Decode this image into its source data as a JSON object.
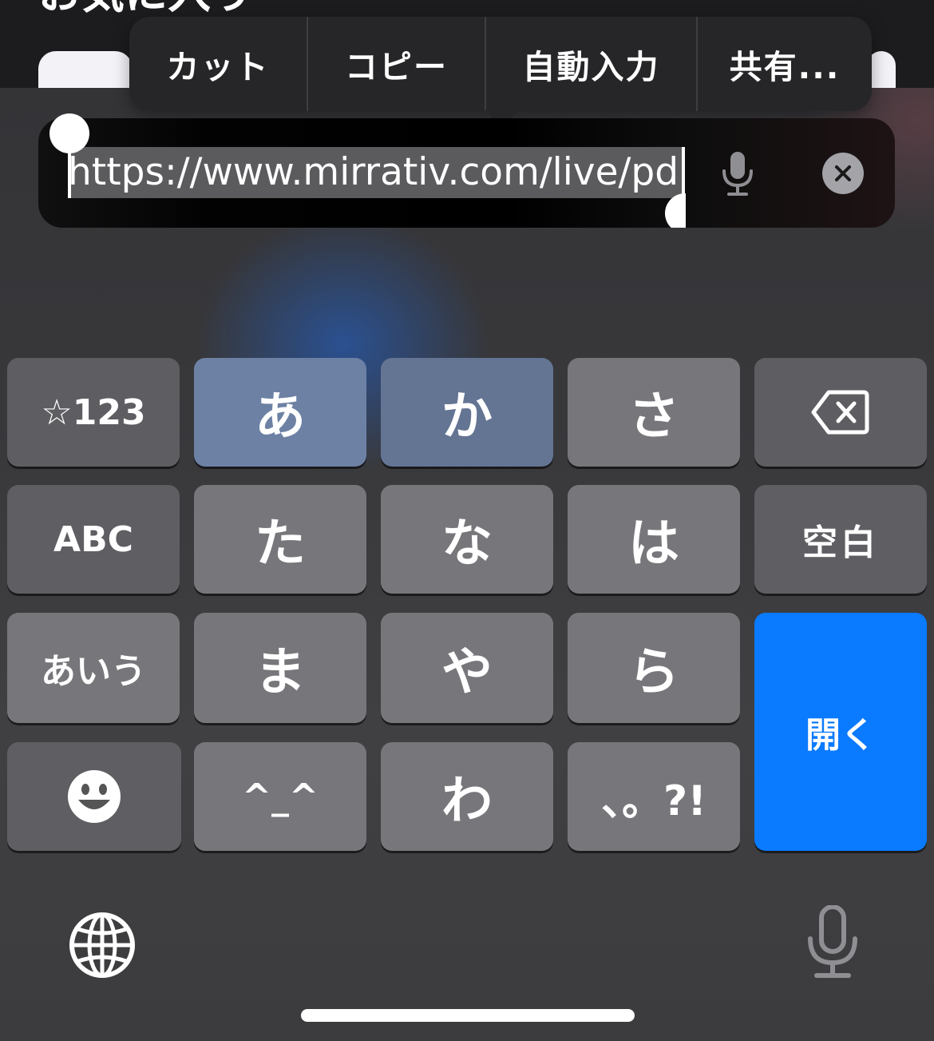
{
  "page": {
    "heading": "お気に入り"
  },
  "edit_menu": {
    "items": [
      "カット",
      "コピー",
      "自動入力",
      "共有..."
    ]
  },
  "url_field": {
    "value": "https://www.mirrativ.com/live/pd"
  },
  "keyboard": {
    "rows": [
      [
        "☆123",
        "あ",
        "か",
        "さ",
        "delete"
      ],
      [
        "ABC",
        "た",
        "な",
        "は",
        "空白"
      ],
      [
        "あいう",
        "ま",
        "や",
        "ら",
        "開く"
      ],
      [
        "emoji",
        "^_^",
        "わ_",
        "、。?!"
      ]
    ],
    "labels": {
      "mode_number": "☆123",
      "a": "あ",
      "ka": "か",
      "sa": "さ",
      "mode_abc": "ABC",
      "ta": "た",
      "na": "な",
      "ha": "は",
      "space": "空白",
      "mode_kana": "あいう",
      "ma": "ま",
      "ya": "や",
      "ra": "ら",
      "open": "開く",
      "kaomoji": "^_^",
      "wa": "わ",
      "punct": "、。?!"
    }
  },
  "colors": {
    "accent": "#0a7aff",
    "menu_background": "#262628"
  },
  "icons": [
    "microphone-icon",
    "clear-icon",
    "delete-icon",
    "emoji-icon",
    "globe-icon",
    "dictation-icon"
  ]
}
